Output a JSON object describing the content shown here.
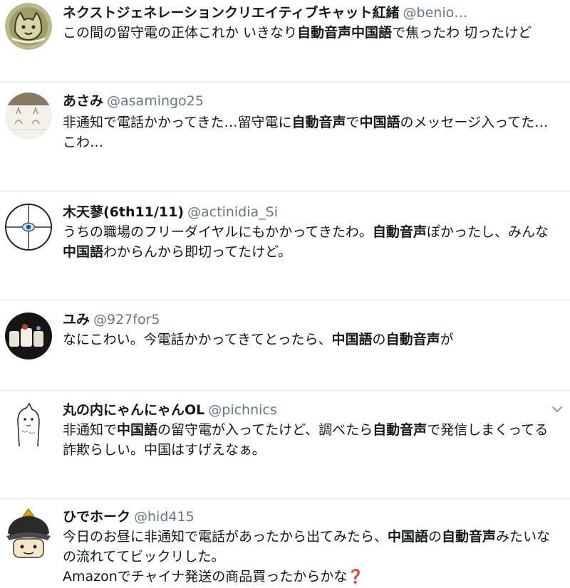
{
  "tweets": [
    {
      "name": "ネクストジェネレーションクリエイティブキャット紅緒",
      "handle": "@benio…",
      "lines": [
        [
          {
            "t": "この間の留守電の正体これか いきなり"
          },
          {
            "t": "自動音声中国語",
            "b": true
          },
          {
            "t": "で焦ったわ 切ったけど"
          }
        ]
      ],
      "avatar_icon": "cat-drawing-avatar"
    },
    {
      "name": "あさみ",
      "handle": "@asamingo25",
      "lines": [
        [
          {
            "t": "非通知で電話かかってきた…留守電に"
          },
          {
            "t": "自動音声",
            "b": true
          },
          {
            "t": "で"
          },
          {
            "t": "中国語",
            "b": true
          },
          {
            "t": "のメッセージ入ってた…"
          }
        ],
        [
          {
            "t": "こわ…"
          }
        ]
      ],
      "avatar_icon": "sketch-avatar"
    },
    {
      "name": "木天蓼(6th11/11)",
      "handle": "@actinidia_Si",
      "lines": [
        [
          {
            "t": "うちの職場のフリーダイヤルにもかかってきたわ。"
          },
          {
            "t": "自動音声",
            "b": true
          },
          {
            "t": "ぽかったし、みんな"
          }
        ],
        [
          {
            "t": "中国語",
            "b": true
          },
          {
            "t": "わからんから即切ってたけど。"
          }
        ]
      ],
      "avatar_icon": "crosshair-eye-avatar"
    },
    {
      "name": "ユみ",
      "handle": "@927for5",
      "lines": [
        [
          {
            "t": "なにこわい。今電話かかってきてとったら、"
          },
          {
            "t": "中国語",
            "b": true
          },
          {
            "t": "の"
          },
          {
            "t": "自動音声",
            "b": true
          },
          {
            "t": "が"
          }
        ]
      ],
      "avatar_icon": "photo-avatar"
    },
    {
      "name": "丸の内にゃんにゃんOL",
      "handle": "@pichnics",
      "lines": [
        [
          {
            "t": "非通知で"
          },
          {
            "t": "中国語",
            "b": true
          },
          {
            "t": "の留守電が入ってたけど、調べたら"
          },
          {
            "t": "自動音声",
            "b": true
          },
          {
            "t": "で発信しまくってる"
          }
        ],
        [
          {
            "t": "詐欺らしい。中国はすげえなぁ。"
          }
        ]
      ],
      "avatar_icon": "cat-doodle-avatar",
      "has_menu": true
    },
    {
      "name": "ひでホーク",
      "handle": "@hid415",
      "lines": [
        [
          {
            "t": "今日のお昼に非通知で電話があったから出てみたら、"
          },
          {
            "t": "中国語",
            "b": true
          },
          {
            "t": "の"
          },
          {
            "t": "自動音声",
            "b": true
          },
          {
            "t": "みたいな"
          }
        ],
        [
          {
            "t": "の流れててビックリした。"
          }
        ],
        [
          {
            "t": "Amazonでチャイナ発送の商品買ったからかな"
          },
          {
            "t": "❓",
            "q": true
          }
        ]
      ],
      "avatar_icon": "samurai-helmet-avatar"
    }
  ],
  "colors": {
    "name": "#14171a",
    "handle": "#657786",
    "divider": "#e1e8ed",
    "question_mark": "#d0112b"
  }
}
